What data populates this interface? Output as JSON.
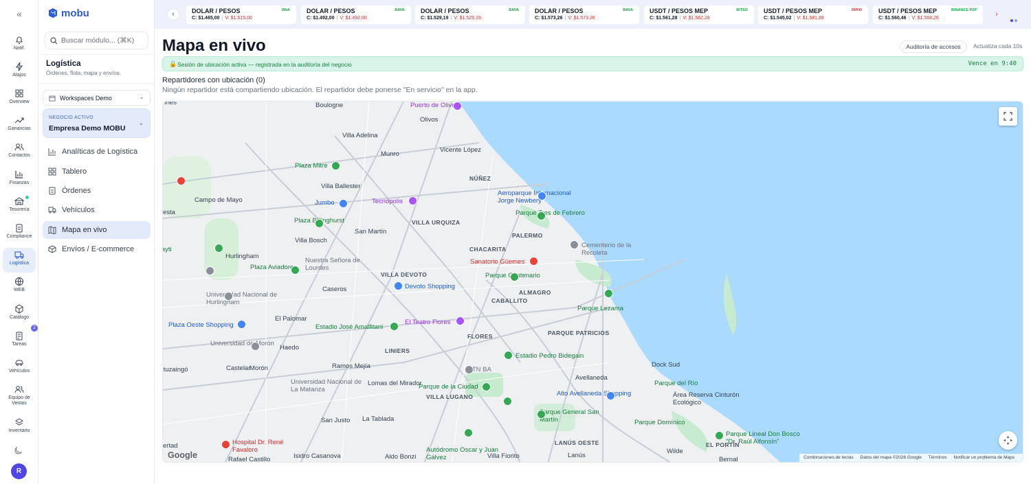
{
  "rail": {
    "items": [
      {
        "label": "Notif.",
        "icon": "bell-icon"
      },
      {
        "label": "Atajos",
        "icon": "bolt-icon"
      },
      {
        "label": "Overview",
        "icon": "grid-icon"
      },
      {
        "label": "Ganancias",
        "icon": "trending-up-icon"
      },
      {
        "label": "Contactos",
        "icon": "users-icon"
      },
      {
        "label": "Finanzas",
        "icon": "bar-chart-icon"
      },
      {
        "label": "Tesorería",
        "icon": "bank-icon"
      },
      {
        "label": "Compliance",
        "icon": "clipboard-icon"
      },
      {
        "label": "Logística",
        "icon": "truck-icon"
      },
      {
        "label": "WEB",
        "icon": "globe-icon"
      },
      {
        "label": "Catálogo",
        "icon": "box-icon"
      },
      {
        "label": "Tareas",
        "icon": "clipboard-list-icon"
      },
      {
        "label": "Vehículos",
        "icon": "car-icon"
      },
      {
        "label": "Equipo de Ventas",
        "icon": "team-icon"
      },
      {
        "label": "Inventario",
        "icon": "layers-icon"
      }
    ],
    "tasks_badge": "2",
    "avatar": "R"
  },
  "sidebar": {
    "brand": "mobu",
    "search_placeholder": "Buscar módulo... (⌘K)",
    "section_title": "Logística",
    "section_subtitle": "Órdenes, flota, mapa y envíos.",
    "workspace": "Workspaces Demo",
    "business_overline": "NEGOCIO ACTIVO",
    "business_name": "Empresa Demo MOBU",
    "nav": [
      {
        "label": "Analíticas de Logística"
      },
      {
        "label": "Tablero"
      },
      {
        "label": "Órdenes"
      },
      {
        "label": "Vehículos"
      },
      {
        "label": "Mapa en vivo"
      },
      {
        "label": "Envíos / E-commerce"
      }
    ]
  },
  "ticker": [
    {
      "title": "DOLAR / PESOS",
      "source": "BNA",
      "buy": "C: $1.465,00",
      "sell": "V: $1.515,00"
    },
    {
      "title": "DOLAR / PESOS",
      "source": "BAVA",
      "buy": "C: $1.492,00",
      "sell": "V: $1.492,00"
    },
    {
      "title": "DOLAR / PESOS",
      "source": "BAVA",
      "buy": "C: $1.529,19",
      "sell": "V: $1.529,19"
    },
    {
      "title": "DOLAR / PESOS",
      "source": "BAVA",
      "buy": "C: $1.573,26",
      "sell": "V: $1.573,26"
    },
    {
      "title": "USDT / PESOS MEP",
      "source": "BITSO",
      "buy": "C: $1.561,28",
      "sell": "V: $1.562,28"
    },
    {
      "title": "USDT / PESOS MEP",
      "source": "RIPIO",
      "buy": "C: $1.545,02",
      "sell": "V: $1.581,88"
    },
    {
      "title": "USDT / PESOS MEP",
      "source": "BINANCE P2P",
      "buy": "C: $1.560,46",
      "sell": "V: $1.568,26"
    }
  ],
  "main": {
    "title": "Mapa en vivo",
    "audit_button": "Auditoría de accesos",
    "refresh_text": "Actualiza cada 10s",
    "session_text": "Sesión de ubicación activa — registrada en la auditoría del negocio",
    "session_expiry": "Vence en 9:40",
    "riders_title": "Repartidores con ubicación (0)",
    "riders_empty": "Ningún repartidor está compartiendo ubicación. El repartidor debe ponerse \"En servicio\" en la app."
  },
  "map": {
    "labels": [
      {
        "text": "Boulogne",
        "style": ""
      },
      {
        "text": "Puerto de Olivos",
        "style": "purple"
      },
      {
        "text": "Olivos",
        "style": ""
      },
      {
        "text": "Villa Adelina",
        "style": ""
      },
      {
        "text": "Munro",
        "style": ""
      },
      {
        "text": "Vicente López",
        "style": ""
      },
      {
        "text": "Plaza Mitre",
        "style": "green"
      },
      {
        "text": "NÚÑEZ",
        "style": "bold"
      },
      {
        "text": "Villa Ballester",
        "style": ""
      },
      {
        "text": "Aeroparque Internacional Jorge Newbery",
        "style": "blue"
      },
      {
        "text": "Campo de Mayo",
        "style": ""
      },
      {
        "text": "Jumbo",
        "style": "blue"
      },
      {
        "text": "Tecnópolis",
        "style": "purple"
      },
      {
        "text": "Parque Tres de Febrero",
        "style": "green"
      },
      {
        "text": "Plaza Billinghurst",
        "style": "green"
      },
      {
        "text": "VILLA URQUIZA",
        "style": "bold"
      },
      {
        "text": "San Martín",
        "style": ""
      },
      {
        "text": "PALERMO",
        "style": "bold"
      },
      {
        "text": "Villa Bosch",
        "style": ""
      },
      {
        "text": "Cementerio de la Recoleta",
        "style": "gray"
      },
      {
        "text": "Curupayti",
        "style": "green"
      },
      {
        "text": "CHACARITA",
        "style": "bold"
      },
      {
        "text": "Hurlingham",
        "style": ""
      },
      {
        "text": "Sanatorio Güemes",
        "style": "red"
      },
      {
        "text": "Nuestra Señora de Lourdes",
        "style": "gray"
      },
      {
        "text": "Plaza Aviadores",
        "style": "green"
      },
      {
        "text": "VILLA DEVOTO",
        "style": "bold"
      },
      {
        "text": "Parque Centenario",
        "style": "green"
      },
      {
        "text": "Devoto Shopping",
        "style": "blue"
      },
      {
        "text": "Universidad Nacional de Hurlingham",
        "style": "gray"
      },
      {
        "text": "Caseros",
        "style": ""
      },
      {
        "text": "ALMAGRO",
        "style": "bold"
      },
      {
        "text": "CABALLITO",
        "style": "bold"
      },
      {
        "text": "Parque Lezama",
        "style": "green"
      },
      {
        "text": "El Palomar",
        "style": ""
      },
      {
        "text": "Plaza Oeste Shopping",
        "style": "blue"
      },
      {
        "text": "Estadio José Amalfitani",
        "style": "green"
      },
      {
        "text": "El Teatro Flores",
        "style": "purple"
      },
      {
        "text": "Universidad de Morón",
        "style": "gray"
      },
      {
        "text": "FLORES",
        "style": "bold"
      },
      {
        "text": "PARQUE PATRICIOS",
        "style": "bold"
      },
      {
        "text": "Haedo",
        "style": ""
      },
      {
        "text": "LINIERS",
        "style": "bold"
      },
      {
        "text": "Estadio Pedro Bidegain",
        "style": "green"
      },
      {
        "text": "Dock Sud",
        "style": ""
      },
      {
        "text": "Ituzaingó",
        "style": ""
      },
      {
        "text": "Castelar",
        "style": ""
      },
      {
        "text": "Morón",
        "style": ""
      },
      {
        "text": "Ramos Mejía",
        "style": ""
      },
      {
        "text": "UTN BA",
        "style": "gray"
      },
      {
        "text": "Avellaneda",
        "style": ""
      },
      {
        "text": "Lomas del Mirador",
        "style": ""
      },
      {
        "text": "Parque de la Ciudad",
        "style": "green"
      },
      {
        "text": "Parque del Río",
        "style": "green"
      },
      {
        "text": "Universidad Nacional de La Matanza",
        "style": "gray"
      },
      {
        "text": "VILLA LUGANO",
        "style": "bold"
      },
      {
        "text": "Alto Avellaneda Shopping",
        "style": "blue"
      },
      {
        "text": "Área Reserva Cinturón Ecológico",
        "style": ""
      },
      {
        "text": "Parque General San Martín",
        "style": "green"
      },
      {
        "text": "San Justo",
        "style": ""
      },
      {
        "text": "La Tablada",
        "style": ""
      },
      {
        "text": "Parque Domínico",
        "style": "green"
      },
      {
        "text": "Autódromo Oscar y Juan Gálvez",
        "style": "green"
      },
      {
        "text": "Parque Lineal Don Bosco \"Dr. Raúl Alfonsín\"",
        "style": "green"
      },
      {
        "text": "Hospital Dr. René Favaloro",
        "style": "red"
      },
      {
        "text": "LANÚS OESTE",
        "style": "bold"
      },
      {
        "text": "EL PORTÍN",
        "style": "bold"
      },
      {
        "text": "Wilde",
        "style": ""
      },
      {
        "text": "Rafael Castillo",
        "style": ""
      },
      {
        "text": "Isidro Casanova",
        "style": ""
      },
      {
        "text": "Aldo Bonzi",
        "style": ""
      },
      {
        "text": "Villa Fiorito",
        "style": ""
      },
      {
        "text": "Lanús",
        "style": ""
      },
      {
        "text": "Bernal",
        "style": ""
      },
      {
        "text": "Ines",
        "style": ""
      },
      {
        "text": "esta",
        "style": ""
      },
      {
        "text": "ertad",
        "style": ""
      }
    ],
    "google_logo": "Google",
    "attribution": [
      "Combinaciones de teclas",
      "Datos del mapa ©2026 Google",
      "Términos",
      "Notificar un problema de Maps"
    ]
  }
}
